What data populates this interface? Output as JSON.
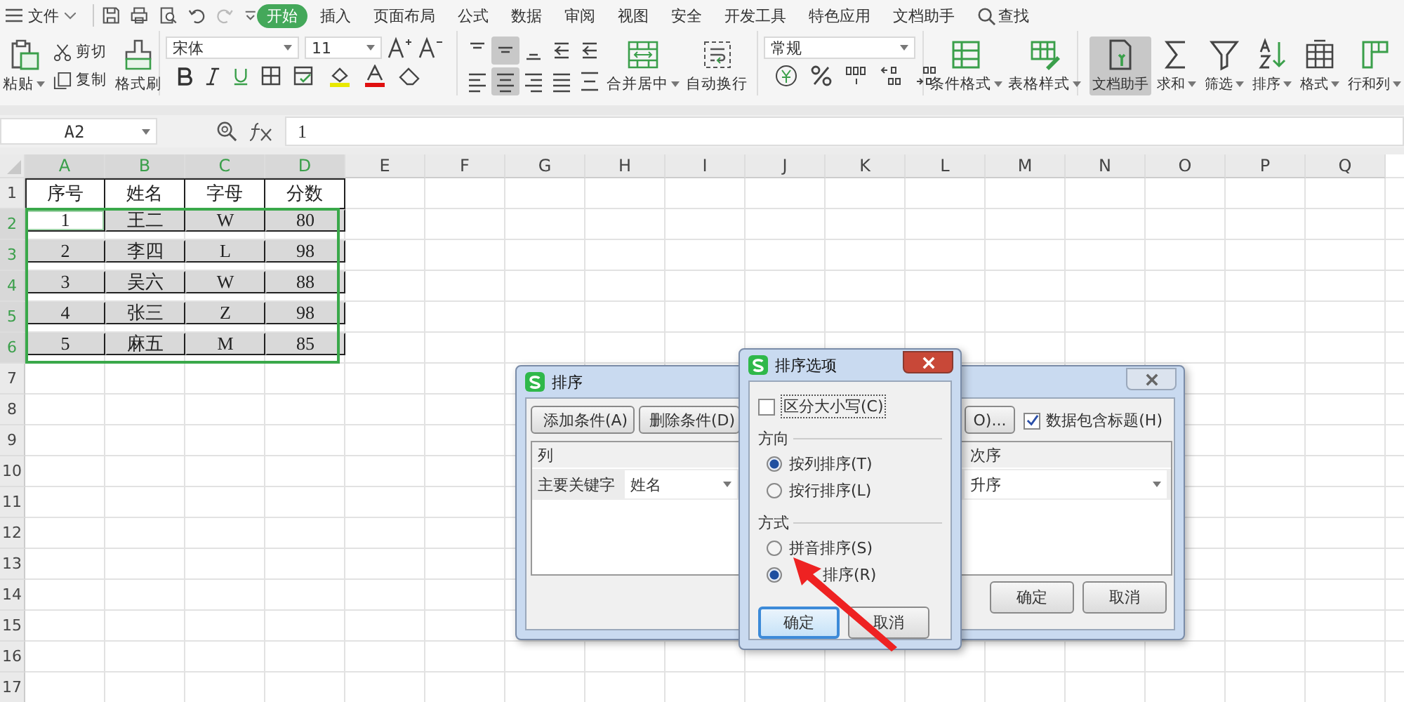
{
  "menu": {
    "file_label": "文件",
    "tabs": [
      {
        "label": "开始",
        "selected": true
      },
      {
        "label": "插入",
        "selected": false
      },
      {
        "label": "页面布局",
        "selected": false
      },
      {
        "label": "公式",
        "selected": false
      },
      {
        "label": "数据",
        "selected": false
      },
      {
        "label": "审阅",
        "selected": false
      },
      {
        "label": "视图",
        "selected": false
      },
      {
        "label": "安全",
        "selected": false
      },
      {
        "label": "开发工具",
        "selected": false
      },
      {
        "label": "特色应用",
        "selected": false
      },
      {
        "label": "文档助手",
        "selected": false
      }
    ],
    "search_label": "查找"
  },
  "ribbon": {
    "clipboard": {
      "paste": "粘贴",
      "cut": "剪切",
      "copy": "复制",
      "format_painter": "格式刷"
    },
    "font": {
      "name": "宋体",
      "size": "11"
    },
    "align_top": [
      {
        "selected": false
      },
      {
        "selected": true
      },
      {
        "selected": false
      },
      {
        "selected": false
      },
      {
        "selected": false
      }
    ],
    "align_bottom": [
      {
        "selected": false
      },
      {
        "selected": true
      },
      {
        "selected": false
      },
      {
        "selected": false
      },
      {
        "selected": false
      }
    ],
    "merge": "合并居中",
    "wrap": "自动换行",
    "number_format": "常规",
    "styles": [
      {
        "label": "条件格式"
      },
      {
        "label": "表格样式"
      }
    ],
    "tools": [
      {
        "label": "文档助手",
        "selected": true
      },
      {
        "label": "求和",
        "selected": false
      },
      {
        "label": "筛选",
        "selected": false
      },
      {
        "label": "排序",
        "selected": false
      },
      {
        "label": "格式",
        "selected": false
      },
      {
        "label": "行和列",
        "selected": false
      }
    ]
  },
  "formula_bar": {
    "name_box": "A2",
    "value": "1"
  },
  "sheet": {
    "columns": [
      {
        "label": "A",
        "selected": true
      },
      {
        "label": "B",
        "selected": true
      },
      {
        "label": "C",
        "selected": true
      },
      {
        "label": "D",
        "selected": true
      },
      {
        "label": "E",
        "selected": false
      },
      {
        "label": "F",
        "selected": false
      },
      {
        "label": "G",
        "selected": false
      },
      {
        "label": "H",
        "selected": false
      },
      {
        "label": "I",
        "selected": false
      },
      {
        "label": "J",
        "selected": false
      },
      {
        "label": "K",
        "selected": false
      },
      {
        "label": "L",
        "selected": false
      },
      {
        "label": "M",
        "selected": false
      },
      {
        "label": "N",
        "selected": false
      },
      {
        "label": "O",
        "selected": false
      },
      {
        "label": "P",
        "selected": false
      },
      {
        "label": "Q",
        "selected": false
      }
    ],
    "rows": [
      {
        "label": "1",
        "selected": false,
        "cells": [
          {
            "text": "序号",
            "selected": false,
            "active": false
          },
          {
            "text": "姓名",
            "selected": false,
            "active": false
          },
          {
            "text": "字母",
            "selected": false,
            "active": false
          },
          {
            "text": "分数",
            "selected": false,
            "active": false
          }
        ]
      },
      {
        "label": "2",
        "selected": true,
        "cells": [
          {
            "text": "1",
            "selected": true,
            "active": true
          },
          {
            "text": "王二",
            "selected": true,
            "active": false
          },
          {
            "text": "W",
            "selected": true,
            "active": false
          },
          {
            "text": "80",
            "selected": true,
            "active": false
          }
        ]
      },
      {
        "label": "3",
        "selected": true,
        "cells": [
          {
            "text": "2",
            "selected": true,
            "active": false
          },
          {
            "text": "李四",
            "selected": true,
            "active": false
          },
          {
            "text": "L",
            "selected": true,
            "active": false
          },
          {
            "text": "98",
            "selected": true,
            "active": false
          }
        ]
      },
      {
        "label": "4",
        "selected": true,
        "cells": [
          {
            "text": "3",
            "selected": true,
            "active": false
          },
          {
            "text": "吴六",
            "selected": true,
            "active": false
          },
          {
            "text": "W",
            "selected": true,
            "active": false
          },
          {
            "text": "88",
            "selected": true,
            "active": false
          }
        ]
      },
      {
        "label": "5",
        "selected": true,
        "cells": [
          {
            "text": "4",
            "selected": true,
            "active": false
          },
          {
            "text": "张三",
            "selected": true,
            "active": false
          },
          {
            "text": "Z",
            "selected": true,
            "active": false
          },
          {
            "text": "98",
            "selected": true,
            "active": false
          }
        ]
      },
      {
        "label": "6",
        "selected": true,
        "cells": [
          {
            "text": "5",
            "selected": true,
            "active": false
          },
          {
            "text": "麻五",
            "selected": true,
            "active": false
          },
          {
            "text": "M",
            "selected": true,
            "active": false
          },
          {
            "text": "85",
            "selected": true,
            "active": false
          }
        ]
      },
      {
        "label": "7",
        "selected": false,
        "cells": []
      },
      {
        "label": "8",
        "selected": false,
        "cells": []
      },
      {
        "label": "9",
        "selected": false,
        "cells": []
      },
      {
        "label": "10",
        "selected": false,
        "cells": []
      },
      {
        "label": "11",
        "selected": false,
        "cells": []
      },
      {
        "label": "12",
        "selected": false,
        "cells": []
      },
      {
        "label": "13",
        "selected": false,
        "cells": []
      },
      {
        "label": "14",
        "selected": false,
        "cells": []
      },
      {
        "label": "15",
        "selected": false,
        "cells": []
      },
      {
        "label": "16",
        "selected": false,
        "cells": []
      },
      {
        "label": "17",
        "selected": false,
        "cells": []
      }
    ]
  },
  "sort_dialog": {
    "title": "排序",
    "add_button": "添加条件(A)",
    "delete_button": "删除条件(D)",
    "options_button": "O)...",
    "header_checkbox": {
      "label": "数据包含标题(H)",
      "checked": true
    },
    "columns": [
      "列",
      "次序"
    ],
    "key_label": "主要关键字",
    "key_value": "姓名",
    "order_value": "升序",
    "ok": "确定",
    "cancel": "取消"
  },
  "options_dialog": {
    "title": "排序选项",
    "case_checkbox": {
      "label": "区分大小写(C)",
      "checked": false
    },
    "direction_label": "方向",
    "directions": [
      {
        "label": "按列排序(T)",
        "selected": true
      },
      {
        "label": "按行排序(L)",
        "selected": false
      }
    ],
    "method_label": "方式",
    "methods": [
      {
        "label": "拼音排序(S)",
        "selected": false
      },
      {
        "label": "排序(R)",
        "selected": true
      }
    ],
    "ok": "确定",
    "cancel": "取消"
  }
}
